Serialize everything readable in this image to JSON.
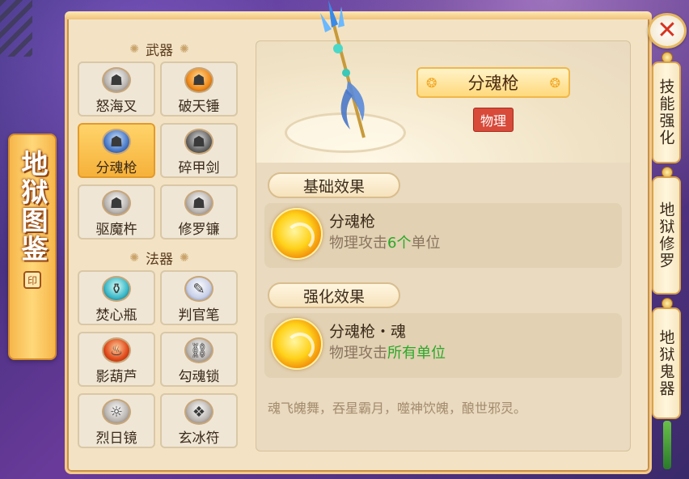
{
  "banner": {
    "title": "地狱图鉴",
    "seal": "印"
  },
  "categories": [
    {
      "label": "武器",
      "items": [
        {
          "label": "怒海叉",
          "icon": "mask-icon"
        },
        {
          "label": "破天锤",
          "icon": "mask-icon"
        },
        {
          "label": "分魂枪",
          "icon": "mask-icon",
          "selected": true
        },
        {
          "label": "碎甲剑",
          "icon": "mask-icon"
        },
        {
          "label": "驱魔杵",
          "icon": "mask-icon"
        },
        {
          "label": "修罗镰",
          "icon": "mask-icon"
        }
      ]
    },
    {
      "label": "法器",
      "items": [
        {
          "label": "焚心瓶",
          "icon": "bottle-icon"
        },
        {
          "label": "判官笔",
          "icon": "brush-icon"
        },
        {
          "label": "影葫芦",
          "icon": "gourd-icon"
        },
        {
          "label": "勾魂锁",
          "icon": "lock-icon"
        },
        {
          "label": "烈日镜",
          "icon": "mirror-icon"
        },
        {
          "label": "玄冰符",
          "icon": "talisman-icon"
        }
      ]
    }
  ],
  "detail": {
    "title": "分魂枪",
    "tag": "物理",
    "base_header": "基础效果",
    "base_effect": {
      "name": "分魂枪",
      "desc_prefix": "物理攻击",
      "desc_highlight": "6个",
      "desc_suffix": "单位"
    },
    "enhanced_header": "强化效果",
    "enhanced_effect": {
      "name": "分魂枪・魂",
      "desc_prefix": "物理攻击",
      "desc_highlight": "所有单位",
      "desc_suffix": ""
    },
    "flavor": "魂飞魄舞，吞星霸月，噬神饮魄，酿世邪灵。"
  },
  "tabs": [
    {
      "label": "技能强化"
    },
    {
      "label": "地狱修罗"
    },
    {
      "label": "地狱鬼器"
    }
  ],
  "close_label": "✕",
  "colors": {
    "selected_item": "#f6b13a",
    "highlight_text": "#2aa82a",
    "tag_red": "#d84a3a"
  }
}
